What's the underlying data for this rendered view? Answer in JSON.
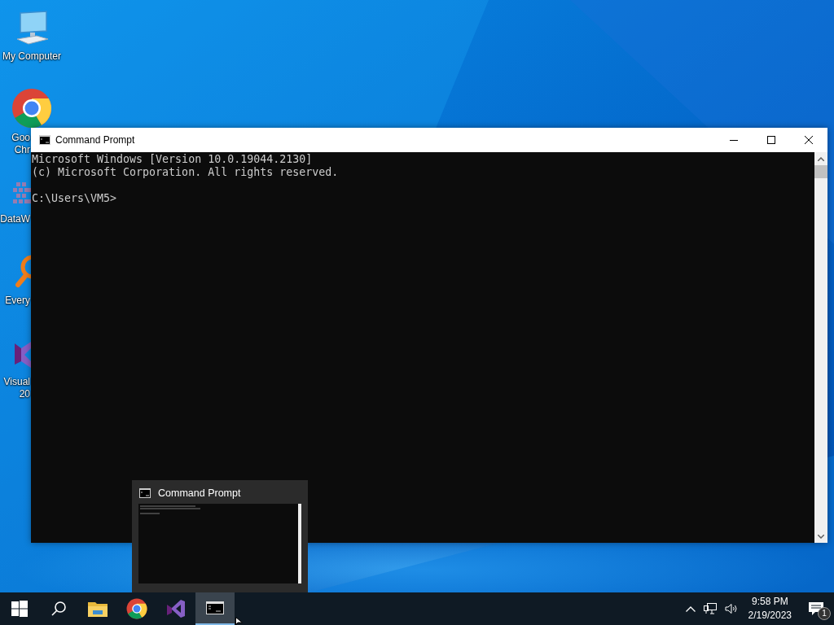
{
  "desktop_icons": [
    {
      "kind": "computer",
      "label_lines": [
        "My Computer"
      ]
    },
    {
      "kind": "chrome",
      "label_lines": [
        "Goo",
        "Chr"
      ]
    },
    {
      "kind": "datawrapper",
      "label_lines": [
        "DataW"
      ]
    },
    {
      "kind": "everything",
      "label_lines": [
        "Every"
      ]
    },
    {
      "kind": "visualstudio",
      "label_lines": [
        "Visual",
        "20"
      ]
    }
  ],
  "window": {
    "title": "Command Prompt",
    "console_blocks": [
      [
        "Microsoft Windows [Version 10.0.19044.2130]",
        "(c) Microsoft Corporation. All rights reserved."
      ],
      [
        "C:\\Users\\VM5>"
      ]
    ]
  },
  "taskbar_preview": {
    "title": "Command Prompt"
  },
  "taskbar": {
    "apps": [
      {
        "kind": "start",
        "selected": false
      },
      {
        "kind": "search",
        "selected": false
      },
      {
        "kind": "explorer",
        "selected": false
      },
      {
        "kind": "chrome",
        "selected": false
      },
      {
        "kind": "visualstudio",
        "selected": false
      },
      {
        "kind": "cmd",
        "selected": true
      }
    ],
    "tray": {
      "time": "9:58 PM",
      "date": "2/19/2023",
      "notification_count": "1"
    }
  }
}
